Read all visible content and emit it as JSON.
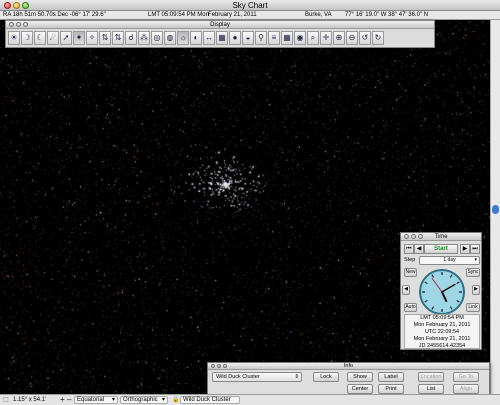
{
  "window": {
    "title": "Sky Chart"
  },
  "status": {
    "coords": "RA 18h 51m 50.70s Dec -06° 17' 29.6\"",
    "time": "LMT 05:09:54 PM Mon",
    "date": "February 21, 2011",
    "location": "Burke, VA",
    "latlon": "77° 16' 19.0\" W  38° 47' 36.0\" N"
  },
  "display_window": {
    "title": "Display",
    "tools": [
      "sun-icon",
      "moon-icon",
      "crescent-icon",
      "comet-icon",
      "pointer-icon",
      "constellation-icon",
      "stars-icon",
      "up-down-arrows-icon",
      "arrows-icon",
      "telescope-icon",
      "cluster-icon",
      "galaxy-icon",
      "nebula-icon",
      "brightness-icon",
      "rotate-icon",
      "flip-icon",
      "dss-image-icon",
      "milky-way-icon",
      "horizon-icon",
      "ecliptic-icon",
      "grid-lines-icon",
      "grid-icon",
      "eye-icon",
      "magnifier-icon",
      "crosshair-icon",
      "zoom-in-icon",
      "zoom-out-icon",
      "reset-icon",
      "refresh-icon"
    ],
    "tool_glyphs": [
      "☀",
      "☽",
      "☾",
      "☄",
      "➚",
      "✦",
      "✧",
      "⇅",
      "⇅",
      "☌",
      "⁂",
      "◎",
      "◍",
      "☼",
      "◐",
      "↔",
      "▦",
      "●",
      "◒",
      "⚲",
      "≡",
      "▦",
      "◉",
      "⌕",
      "✛",
      "⊕",
      "⊖",
      "↺",
      "↻"
    ]
  },
  "bottom": {
    "fov": "1.15° x 54.1'",
    "plus": "+",
    "minus": "–",
    "frame": "Equatorial",
    "projection": "Orthographic",
    "object": "Wild Duck Cluster"
  },
  "time_window": {
    "title": "Time",
    "start_label": "Start",
    "step_label": "Step",
    "step_value": "1 day",
    "new_label": "New",
    "sync_label": "Sync",
    "auto_label": "Auto",
    "link_label": "Link",
    "lmt": "LMT 05:09:54 PM",
    "lmt_date": "Mon February 21, 2011",
    "utc": "UTC 22:09:54",
    "utc_date": "Mon February 21, 2011",
    "jd": "JD 2455614.42354",
    "clock": {
      "hour": 5,
      "minute": 9,
      "second": 54
    }
  },
  "info_window": {
    "title": "Info",
    "object": "Wild Duck Cluster",
    "lock": "Lock",
    "show": "Show",
    "label": "Label",
    "location": "Location",
    "goto": "Go To",
    "center": "Center",
    "print": "Print",
    "list": "List",
    "align": "Align"
  },
  "colors": {
    "sky": "#000000",
    "accent": "#3a7bd5",
    "start": "#1a8a1a",
    "clock_face": "#9ed6e6"
  }
}
